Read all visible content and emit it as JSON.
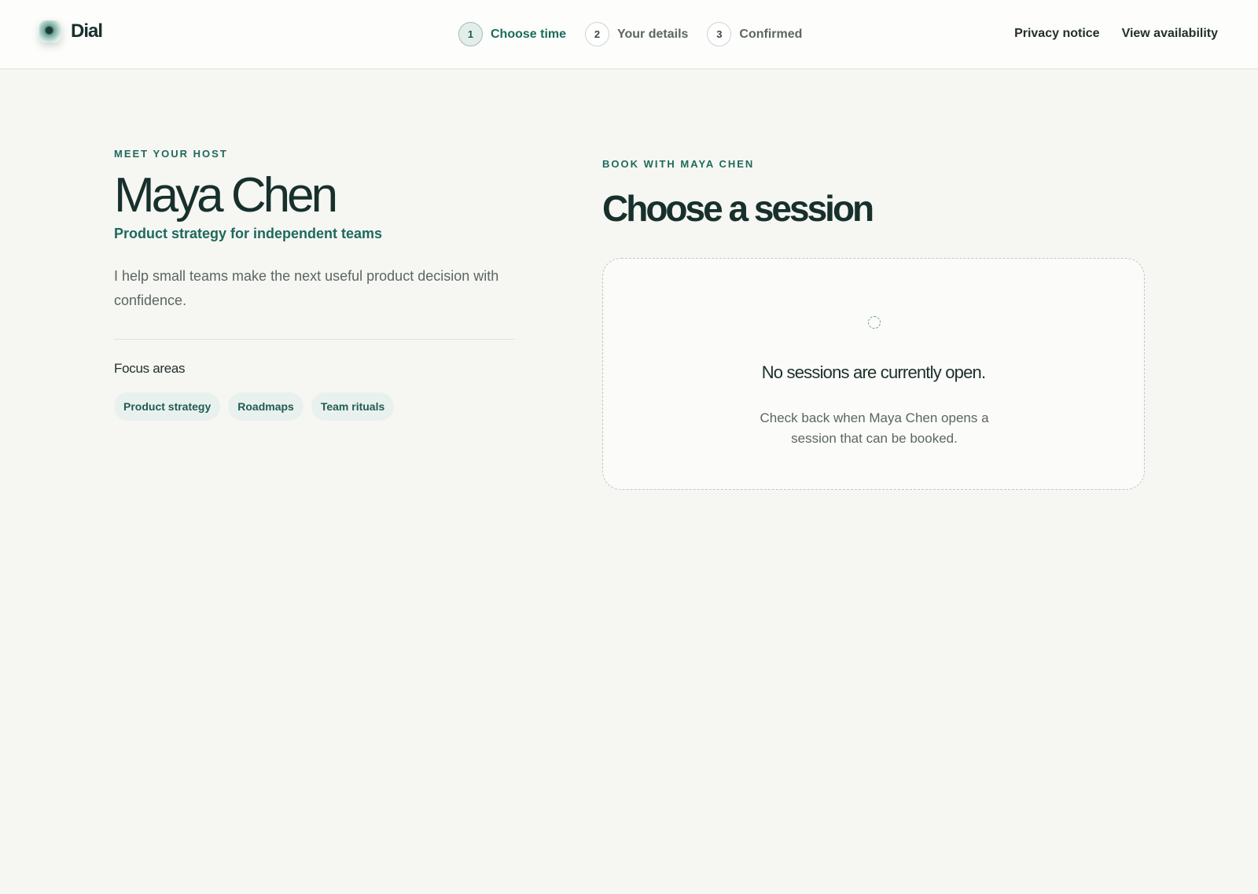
{
  "brand": {
    "name": "Dial",
    "icon": "dial-logo-icon"
  },
  "steps": [
    {
      "number": "1",
      "label": "Choose time",
      "active": true
    },
    {
      "number": "2",
      "label": "Your details",
      "active": false
    },
    {
      "number": "3",
      "label": "Confirmed",
      "active": false
    }
  ],
  "nav": {
    "privacy": "Privacy notice",
    "availability": "View availability"
  },
  "host": {
    "eyebrow": "MEET YOUR HOST",
    "name": "Maya Chen",
    "tagline": "Product strategy for independent teams",
    "bio": "I help small teams make the next useful product decision with confidence.",
    "focus_title": "Focus areas",
    "focus_areas": [
      "Product strategy",
      "Roadmaps",
      "Team rituals"
    ]
  },
  "booking": {
    "eyebrow": "BOOK WITH MAYA CHEN",
    "title": "Choose a session",
    "empty_icon": "dashed-circle-icon",
    "empty_title": "No sessions are currently open.",
    "empty_text": "Check back when Maya Chen opens a session that can be booked."
  },
  "colors": {
    "accent": "#1d6a5b",
    "background": "#f6f6f3",
    "header_bg": "#fdfdfb",
    "chip_bg": "#e9f1ee",
    "text_dark": "#17302c",
    "text_muted": "#5b6663"
  }
}
